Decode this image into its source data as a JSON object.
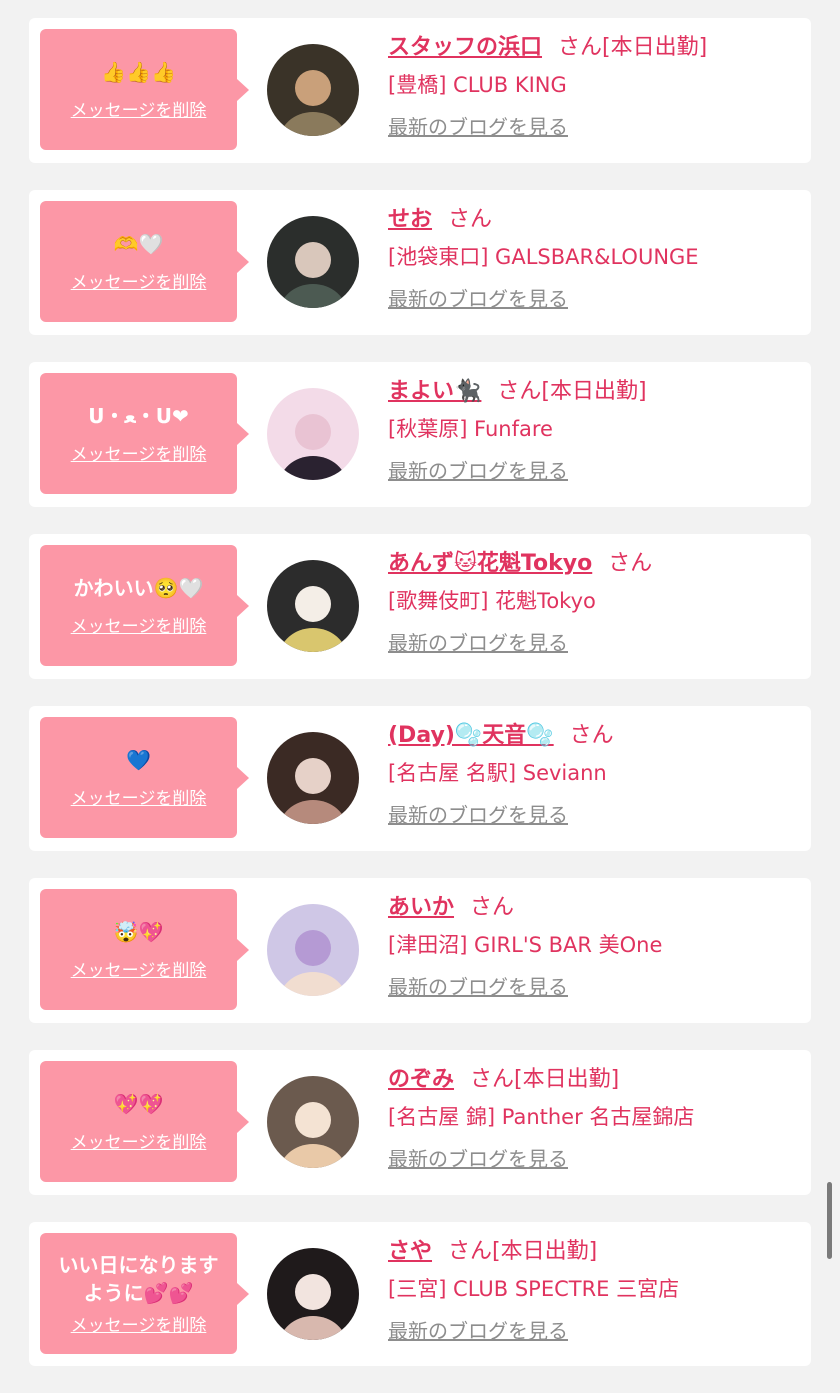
{
  "cards": [
    {
      "message": "👍👍👍",
      "delete_label": "メッセージを削除",
      "name": "スタッフの浜口",
      "suffix": "さん",
      "attendance": "[本日出勤]",
      "shop": "[豊橋] CLUB KING",
      "blog_label": "最新のブログを見る",
      "avatar_colors": [
        "#3a3328",
        "#8a7a5c",
        "#c9a07a"
      ]
    },
    {
      "message": "🫶🤍",
      "delete_label": "メッセージを削除",
      "name": "せお",
      "suffix": "さん",
      "attendance": "",
      "shop": "[池袋東口] GALSBAR&LOUNGE",
      "blog_label": "最新のブログを見る",
      "avatar_colors": [
        "#2b2e2c",
        "#4c5a52",
        "#d9c7bb"
      ]
    },
    {
      "message": "U・ﻌ・U❤",
      "delete_label": "メッセージを削除",
      "name": "まよい🐈‍⬛",
      "suffix": "さん",
      "attendance": "[本日出勤]",
      "shop": "[秋葉原] Funfare",
      "blog_label": "最新のブログを見る",
      "avatar_colors": [
        "#f3dbe8",
        "#2a2230",
        "#e9c3d3"
      ]
    },
    {
      "message": "かわいい🥺🤍",
      "delete_label": "メッセージを削除",
      "name": "あんず🐱花魁Tokyo",
      "suffix": "さん",
      "attendance": "",
      "shop": "[歌舞伎町] 花魁Tokyo",
      "blog_label": "最新のブログを見る",
      "avatar_colors": [
        "#2c2c2c",
        "#d9c66e",
        "#f4eee7"
      ]
    },
    {
      "message": "💙",
      "delete_label": "メッセージを削除",
      "name": "(Day)🫧天音🫧",
      "suffix": "さん",
      "attendance": "",
      "shop": "[名古屋 名駅] Seviann",
      "blog_label": "最新のブログを見る",
      "avatar_colors": [
        "#3b2a24",
        "#b68a7c",
        "#e6d1c8"
      ]
    },
    {
      "message": "🤯💖",
      "delete_label": "メッセージを削除",
      "name": "あいか",
      "suffix": "さん",
      "attendance": "",
      "shop": "[津田沼] GIRL'S BAR 美One",
      "blog_label": "最新のブログを見る",
      "avatar_colors": [
        "#cfc7e6",
        "#f1ddd0",
        "#b59ad4"
      ]
    },
    {
      "message": "💖💖",
      "delete_label": "メッセージを削除",
      "name": "のぞみ",
      "suffix": "さん",
      "attendance": "[本日出勤]",
      "shop": "[名古屋 錦] Panther 名古屋錦店",
      "blog_label": "最新のブログを見る",
      "avatar_colors": [
        "#6b5a4e",
        "#e9c9a8",
        "#f4e3d3"
      ]
    },
    {
      "message": "いい日になります\nように💕💕",
      "delete_label": "メッセージを削除",
      "name": "さや",
      "suffix": "さん",
      "attendance": "[本日出勤]",
      "shop": "[三宮] CLUB SPECTRE 三宮店",
      "blog_label": "最新のブログを見る",
      "avatar_colors": [
        "#1f1a1b",
        "#d8b8ae",
        "#f2e4df"
      ]
    }
  ]
}
